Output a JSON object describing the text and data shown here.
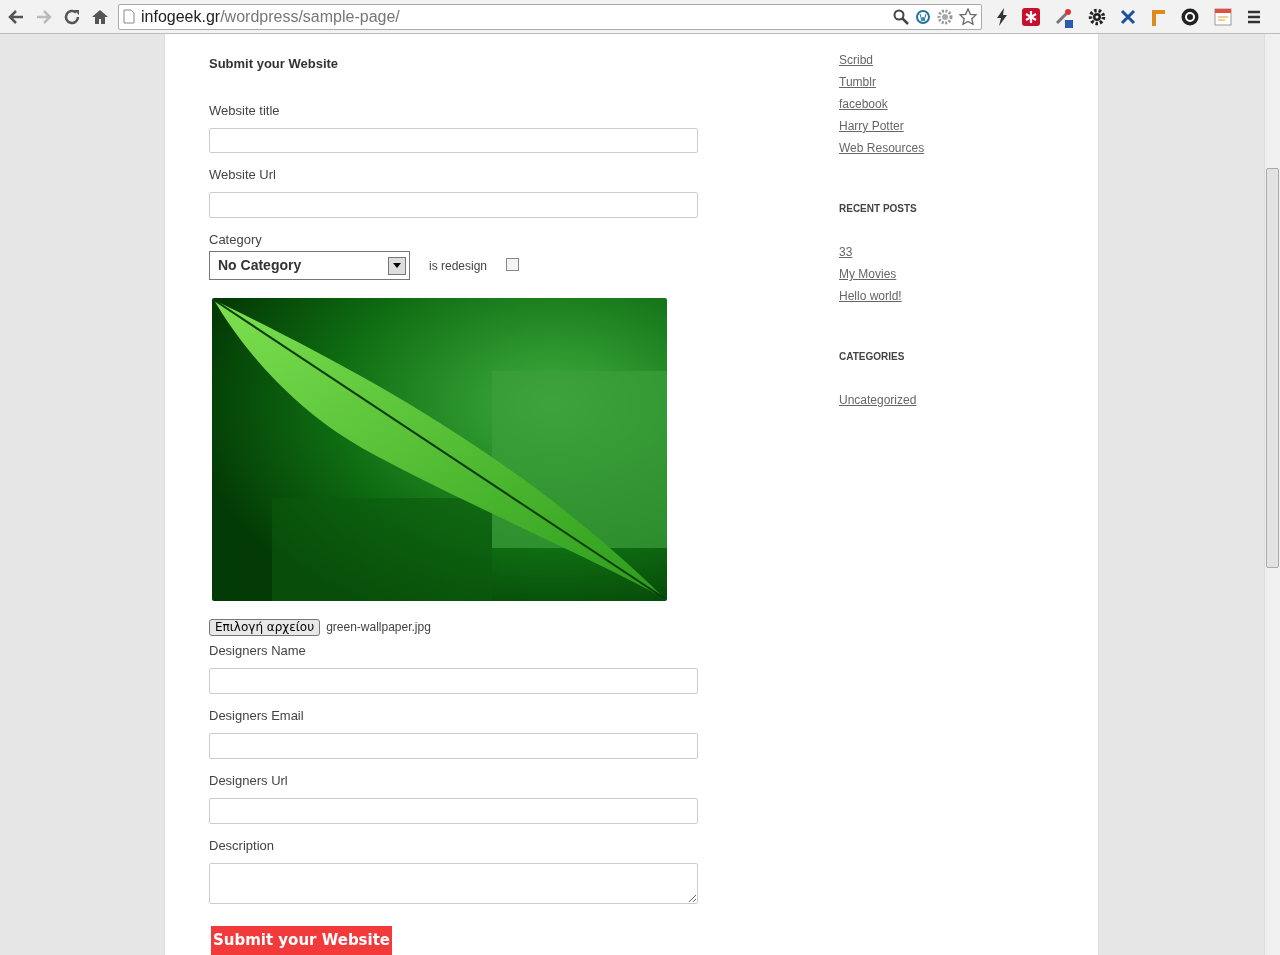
{
  "browser": {
    "url_host": "infogeek.gr",
    "url_path": "/wordpress/sample-page/"
  },
  "form": {
    "title": "Submit your Website",
    "fields": [
      {
        "kind": "text",
        "label": "Website title"
      },
      {
        "kind": "text",
        "label": "Website Url"
      },
      {
        "kind": "select",
        "label": "Category",
        "value": "No Category",
        "checkbox_label": "is redesign",
        "checked": false
      },
      {
        "kind": "image"
      },
      {
        "kind": "file",
        "button": "Επιλογή αρχείου",
        "filename": "green-wallpaper.jpg"
      },
      {
        "kind": "text",
        "label": "Designers Name"
      },
      {
        "kind": "text",
        "label": "Designers Email"
      },
      {
        "kind": "text",
        "label": "Designers Url"
      },
      {
        "kind": "textarea",
        "label": "Description"
      }
    ],
    "submit": "Submit your Website"
  },
  "sidebar": [
    {
      "links": [
        "Scribd",
        "Tumblr",
        "facebook",
        "Harry Potter",
        "Web Resources"
      ]
    },
    {
      "heading": "RECENT POSTS",
      "links": [
        "33",
        "My Movies",
        "Hello world!"
      ]
    },
    {
      "heading": "CATEGORIES",
      "links": [
        "Uncategorized"
      ]
    }
  ]
}
